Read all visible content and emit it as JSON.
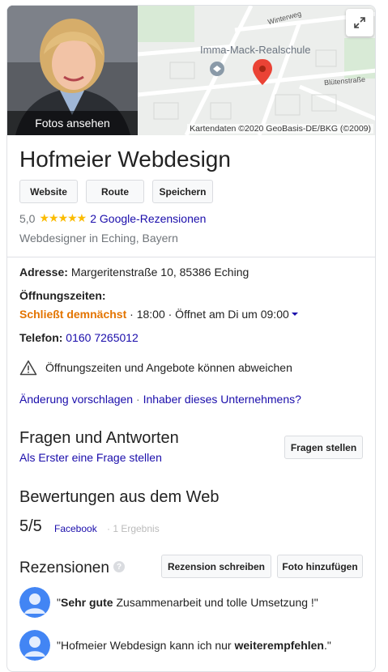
{
  "photo": {
    "label": "Fotos ansehen"
  },
  "map": {
    "attribution": "Kartendaten ©2020 GeoBasis-DE/BKG (©2009)",
    "school_label": "Imma-Mack-Realschule",
    "street_1": "Winterweg",
    "street_2": "Blütenstraße"
  },
  "business": {
    "name": "Hofmeier Webdesign",
    "buttons": [
      "Website",
      "Route",
      "Speichern"
    ],
    "rating_value": "5,0",
    "stars": "★★★★★",
    "reviews_link": "2 Google-Rezensionen",
    "category": "Webdesigner in Eching, Bayern"
  },
  "details": {
    "address_label": "Adresse:",
    "address_value": "Margeritenstraße 10, 85386 Eching",
    "hours_label": "Öffnungszeiten:",
    "hours_status": "Schließt demnächst",
    "hours_detail": " · 18:00 · Öffnet am Di um 09:00",
    "phone_label": "Telefon:",
    "phone_value": "0160 7265012",
    "warning": "Öffnungszeiten und Angebote können abweichen",
    "suggest_edit": "Änderung vorschlagen",
    "separator": " · ",
    "owner_link": "Inhaber dieses Unternehmens?"
  },
  "qa": {
    "heading": "Fragen und Antworten",
    "first_question": "Als Erster eine Frage stellen",
    "ask_button": "Fragen stellen"
  },
  "web_reviews": {
    "heading": "Bewertungen aus dem Web",
    "score": "5/5",
    "source": "Facebook",
    "count": "· 1 Ergebnis"
  },
  "reviews": {
    "heading": "Rezensionen",
    "write_button": "Rezension schreiben",
    "photo_button": "Foto hinzufügen",
    "items": [
      {
        "pre": "\"",
        "bold": "Sehr gute",
        "post": " Zusammenarbeit und tolle Umsetzung !\""
      },
      {
        "pre": "\"Hofmeier Webdesign kann ich nur ",
        "bold": "weiterempfehlen",
        "post": ".\""
      }
    ]
  },
  "colors": {
    "link": "#1a0dab",
    "closing": "#e37400",
    "star": "#fbbc04",
    "pin": "#ea4335"
  }
}
